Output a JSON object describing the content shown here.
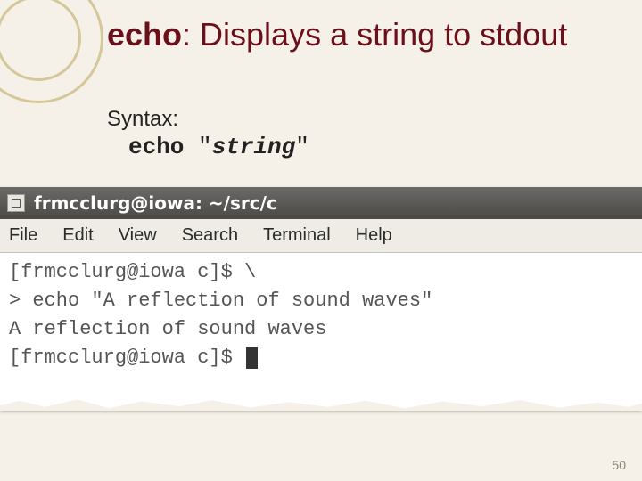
{
  "title_cmd": "echo",
  "title_rest": ": Displays a string to stdout",
  "syntax": {
    "label": "Syntax:",
    "keyword": "echo",
    "quote_open": " \"",
    "arg": "string",
    "quote_close": "\""
  },
  "terminal": {
    "window_title": "frmcclurg@iowa: ~/src/c",
    "menu": {
      "file": "File",
      "edit": "Edit",
      "view": "View",
      "search": "Search",
      "terminal": "Terminal",
      "help": "Help"
    },
    "lines": {
      "l1": "[frmcclurg@iowa c]$ \\",
      "l2": "> echo \"A reflection of sound waves\"",
      "l3": "A reflection of sound waves",
      "l4": "[frmcclurg@iowa c]$ "
    }
  },
  "page_number": "50"
}
